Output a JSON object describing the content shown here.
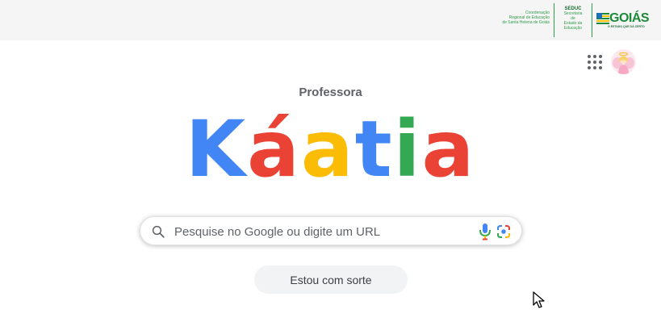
{
  "banner": {
    "regional_lines": [
      "Coordenação",
      "Regional de Educação",
      "de Santa Helena de Goiás"
    ],
    "seduc_title": "SEDUC",
    "seduc_lines": [
      "Secretaria",
      "de",
      "Estado da",
      "Educação"
    ],
    "logo_word": "GOIÁS",
    "logo_tagline": "O ESTADO QUE DÁ CERTO"
  },
  "header": {
    "apps_icon": "apps-grid-icon",
    "avatar_icon": "avatar-image"
  },
  "title": {
    "subtitle": "Professora",
    "letters": [
      {
        "char": "K",
        "color": "#4285F4"
      },
      {
        "char": "á",
        "color": "#EA4335"
      },
      {
        "char": "a",
        "color": "#FBBC05"
      },
      {
        "char": "t",
        "color": "#4285F4"
      },
      {
        "char": "i",
        "color": "#34A853"
      },
      {
        "char": "a",
        "color": "#EA4335"
      }
    ]
  },
  "search": {
    "placeholder": "Pesquise no Google ou digite um URL",
    "value": ""
  },
  "buttons": {
    "lucky_label": "Estou com sorte"
  }
}
